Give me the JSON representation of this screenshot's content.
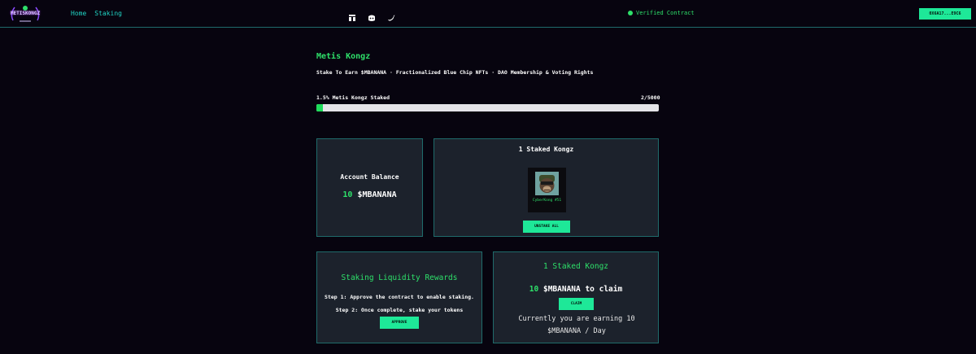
{
  "header": {
    "logo_text": "METISKONGZ",
    "nav": [
      {
        "label": "Home"
      },
      {
        "label": "Staking"
      }
    ],
    "social_icons": [
      "opensea-icon",
      "discord-icon",
      "twitter-icon"
    ],
    "verified_label": "Verified Contract",
    "wallet_label": "0X6A17...E9C6"
  },
  "hero": {
    "title": "Metis Kongz",
    "subtitle": "Stake To Earn $MBANANA · Fractionalized Blue Chip NFTs · DAO Membership & Voting Rights",
    "progress_label": "1.5% Metis Kongz Staked",
    "progress_count": "2/5000",
    "progress_fraction": 0.015
  },
  "balance_card": {
    "label": "Account Balance",
    "amount": "10",
    "token": "$MBANANA"
  },
  "staked_card": {
    "title": "1 Staked Kongz",
    "nft_name": "CyberKong #51",
    "unstake_label": "UNSTAKE ALL"
  },
  "liquidity_card": {
    "title": "Staking Liquidity Rewards",
    "step1": "Step 1: Approve the contract to enable staking.",
    "step2": "Step 2: Once complete, stake your tokens",
    "approve_label": "APPROVE"
  },
  "claim_card": {
    "title": "1 Staked Kongz",
    "amount": "10",
    "suffix": "$MBANANA to claim",
    "claim_label": "CLAIM",
    "earning_text": "Currently you are earning 10 $MBANANA / Day"
  },
  "colors": {
    "background": "#07040f",
    "accent_green": "#2ee06a",
    "button_green": "#1ee898",
    "card_bg": "#1c222c",
    "card_border": "#1f6b6b",
    "nav_teal": "#20d4c4"
  }
}
